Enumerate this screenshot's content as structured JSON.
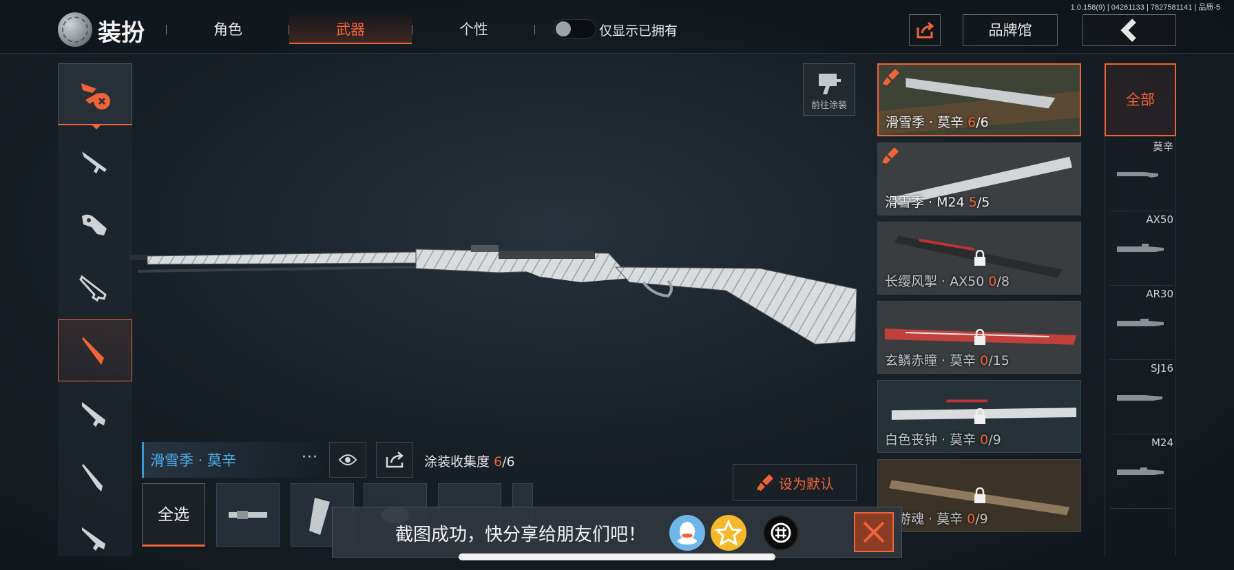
{
  "version": "1.0.158(9) | 04261133 | 7827581141 | 品质-5",
  "header": {
    "title": "装扮",
    "tabs": [
      {
        "label": "角色",
        "active": false
      },
      {
        "label": "武器",
        "active": true
      },
      {
        "label": "个性",
        "active": false
      }
    ],
    "owned_only_label": "仅显示已拥有",
    "owned_only_on": false,
    "brand_label": "品牌馆"
  },
  "colors": {
    "accent": "#f0643a",
    "name_blue": "#4eaee8"
  },
  "paint_button_label": "前往涂装",
  "selected_weapon": {
    "name": "滑雪季 · 莫辛",
    "more": "···",
    "collect_label": "涂装收集度",
    "collect_owned": "6",
    "collect_total": "/6"
  },
  "parts": {
    "select_all": "全选"
  },
  "set_default_label": "设为默认",
  "skins": [
    {
      "name": "滑雪季 · 莫辛 ",
      "owned": "6",
      "total": "/6",
      "locked": false,
      "selected": true
    },
    {
      "name": "滑雪季 · M24 ",
      "owned": "5",
      "total": "/5",
      "locked": false,
      "selected": false
    },
    {
      "name": "长缨风掣 · AX50 ",
      "owned": "0",
      "total": "/8",
      "locked": true,
      "selected": false
    },
    {
      "name": "玄鳞赤瞳 · 莫辛 ",
      "owned": "0",
      "total": "/15",
      "locked": true,
      "selected": false
    },
    {
      "name": "白色丧钟 · 莫辛 ",
      "owned": "0",
      "total": "/9",
      "locked": true,
      "selected": false
    },
    {
      "name": "巫游魂 · 莫辛 ",
      "owned": "0",
      "total": "/9",
      "locked": true,
      "selected": false
    }
  ],
  "weapon_filter": {
    "all_label": "全部",
    "weapons": [
      "莫辛",
      "AX50",
      "AR30",
      "SJ16",
      "M24"
    ]
  },
  "toast": {
    "text": "截图成功，快分享给朋友们吧！"
  }
}
